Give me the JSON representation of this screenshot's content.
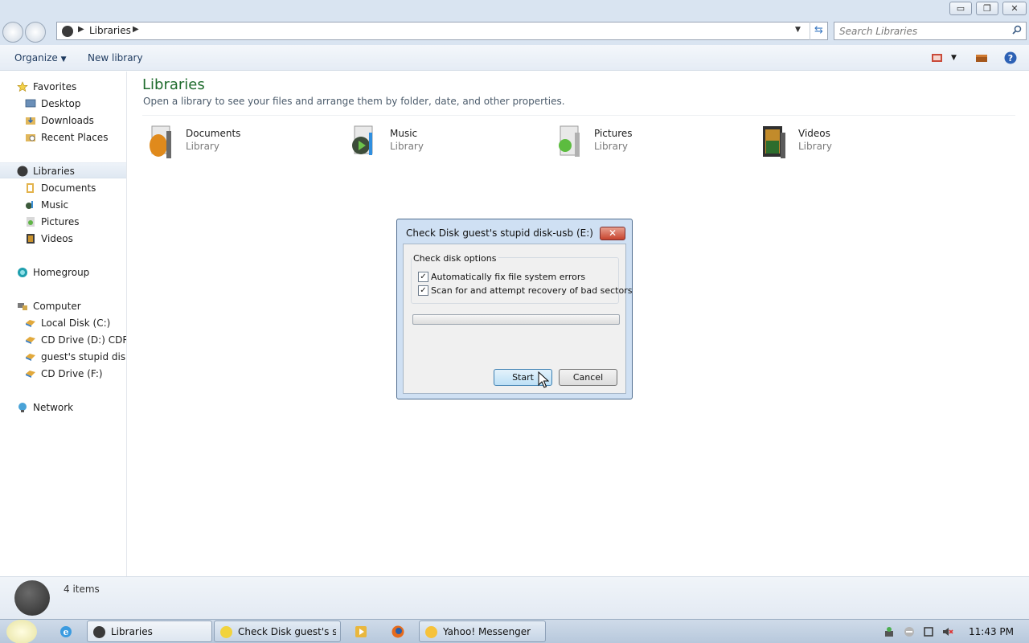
{
  "window": {
    "minimize_glyph": "▭",
    "restore_glyph": "❐",
    "close_glyph": "✕"
  },
  "address": {
    "path": "Libraries",
    "search_placeholder": "Search Libraries"
  },
  "toolbar": {
    "organize": "Organize",
    "new_library": "New library"
  },
  "nav": {
    "favorites": "Favorites",
    "desktop": "Desktop",
    "downloads": "Downloads",
    "recent_places": "Recent Places",
    "libraries": "Libraries",
    "documents": "Documents",
    "music": "Music",
    "pictures": "Pictures",
    "videos": "Videos",
    "homegroup": "Homegroup",
    "computer": "Computer",
    "local_disk": "Local Disk (C:)",
    "cd_drive_d": "CD Drive (D:) CDROM",
    "usb": "guest's stupid disk-usb (E:)",
    "cd_drive_f": "CD Drive (F:)",
    "network": "Network"
  },
  "main": {
    "title": "Libraries",
    "subtitle": "Open a library to see your files and arrange them by folder, date, and other properties.",
    "libraries": [
      {
        "name": "Documents",
        "type": "Library"
      },
      {
        "name": "Music",
        "type": "Library"
      },
      {
        "name": "Pictures",
        "type": "Library"
      },
      {
        "name": "Videos",
        "type": "Library"
      }
    ]
  },
  "dialog": {
    "title": "Check Disk guest's stupid disk-usb (E:)",
    "close_glyph": "✕",
    "group_title": "Check disk options",
    "option1": "Automatically fix file system errors",
    "option1_checked": true,
    "option2": "Scan for and attempt recovery of bad sectors",
    "option2_checked": true,
    "progress": 0,
    "start": "Start",
    "cancel": "Cancel",
    "check_glyph": "✓"
  },
  "status": {
    "items": "4 items"
  },
  "taskbar": {
    "items": [
      {
        "label": "Libraries"
      },
      {
        "label": "Check Disk guest's st..."
      },
      {
        "label": "Yahoo! Messenger"
      }
    ],
    "clock": "11:43 PM"
  },
  "colors": {
    "title_green": "#1e6b2c",
    "accent_blue": "#3a78c2"
  }
}
